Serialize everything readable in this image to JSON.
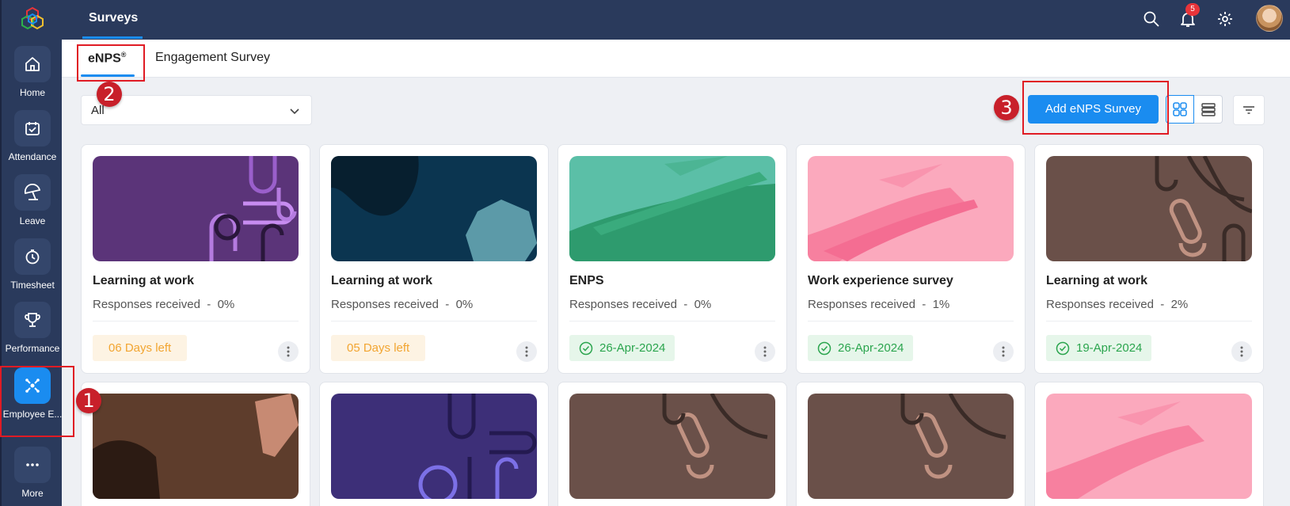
{
  "app": {
    "header_tab": "Surveys",
    "notification_count": "5"
  },
  "sidebar": {
    "items": [
      {
        "label": "Home",
        "icon": "home-icon"
      },
      {
        "label": "Attendance",
        "icon": "calendar-check-icon"
      },
      {
        "label": "Leave",
        "icon": "umbrella-icon"
      },
      {
        "label": "Timesheet",
        "icon": "timer-icon"
      },
      {
        "label": "Performance",
        "icon": "trophy-icon"
      },
      {
        "label": "Employee E...",
        "icon": "engagement-icon",
        "active": true
      },
      {
        "label": "More",
        "icon": "more-icon"
      }
    ]
  },
  "subtabs": {
    "enps_label": "eNPS",
    "enps_sup": "®",
    "engagement_label": "Engagement Survey"
  },
  "toolbar": {
    "filter_value": "All",
    "add_label": "Add eNPS Survey"
  },
  "callouts": [
    "1",
    "2",
    "3"
  ],
  "cards": [
    {
      "title": "Learning at work",
      "responses": "Responses received  -  0%",
      "status": "06 Days left",
      "status_type": "warn",
      "theme": "purple-lines"
    },
    {
      "title": "Learning at work",
      "responses": "Responses received  -  0%",
      "status": "05 Days left",
      "status_type": "warn",
      "theme": "navy-blobs"
    },
    {
      "title": "ENPS",
      "responses": "Responses received  -  0%",
      "status": "26-Apr-2024",
      "status_type": "ok",
      "theme": "green-brush"
    },
    {
      "title": "Work experience survey",
      "responses": "Responses received  -  1%",
      "status": "26-Apr-2024",
      "status_type": "ok",
      "theme": "pink-brush"
    },
    {
      "title": "Learning at work",
      "responses": "Responses received  -  2%",
      "status": "19-Apr-2024",
      "status_type": "ok",
      "theme": "brown-lines"
    }
  ],
  "colors": {
    "accent": "#1a8cf0",
    "sidebar": "#2a3a5c",
    "warn": "#f2a531",
    "ok": "#2ba54e",
    "annotation": "#e01b24"
  }
}
